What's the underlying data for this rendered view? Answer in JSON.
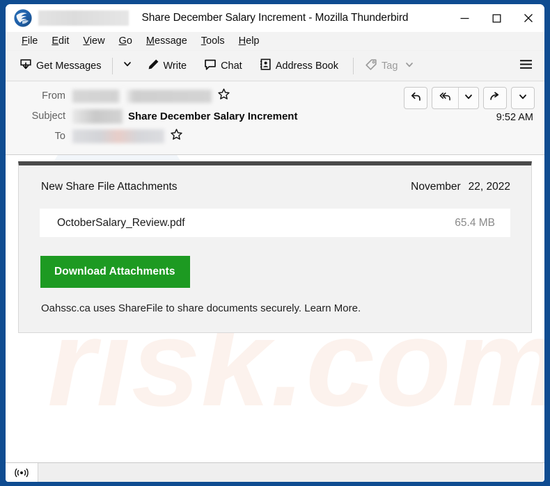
{
  "window": {
    "title": "Share December Salary Increment - Mozilla Thunderbird",
    "app_icon": "thunderbird-icon",
    "controls": {
      "minimize": "minimize-icon",
      "maximize": "maximize-icon",
      "close": "close-icon"
    }
  },
  "menubar": {
    "items": [
      {
        "label": "File",
        "accel": "F"
      },
      {
        "label": "Edit",
        "accel": "E"
      },
      {
        "label": "View",
        "accel": "V"
      },
      {
        "label": "Go",
        "accel": "G"
      },
      {
        "label": "Message",
        "accel": "M"
      },
      {
        "label": "Tools",
        "accel": "T"
      },
      {
        "label": "Help",
        "accel": "H"
      }
    ]
  },
  "toolbar": {
    "get_messages_label": "Get Messages",
    "get_messages_icon": "inbox-download-icon",
    "get_messages_caret": "chevron-down-icon",
    "write_label": "Write",
    "write_icon": "pencil-icon",
    "chat_label": "Chat",
    "chat_icon": "chat-bubble-icon",
    "address_book_label": "Address Book",
    "address_book_icon": "address-book-icon",
    "tag_label": "Tag",
    "tag_icon": "tag-icon",
    "tag_caret": "chevron-down-icon",
    "tag_disabled": true,
    "app_menu_icon": "hamburger-menu-icon"
  },
  "message_header": {
    "from_label": "From",
    "from_value": "",
    "from_redacted": true,
    "from_star_icon": "star-icon",
    "subject_label": "Subject",
    "subject_prefix_redacted": true,
    "subject_value": "Share December Salary Increment",
    "to_label": "To",
    "to_value": "",
    "to_redacted": true,
    "to_star_icon": "star-icon",
    "time": "9:52 AM",
    "actions": {
      "reply_icon": "reply-icon",
      "reply_all_icon": "reply-all-icon",
      "reply_all_caret_icon": "chevron-down-icon",
      "forward_icon": "forward-arrow-icon",
      "more_caret_icon": "chevron-down-icon"
    }
  },
  "email_body": {
    "heading": "New Share File Attachments",
    "date_month": "November",
    "date_day_year": "22, 2022",
    "attachment": {
      "name": "OctoberSalary_Review.pdf",
      "size": "65.4 MB"
    },
    "download_button_label": "Download Attachments",
    "footer_text": "Oahssc.ca uses ShareFile to share documents securely. ",
    "footer_link": "Learn More.",
    "accent_color": "#1d9a22",
    "card_top_bar_color": "#4a4a4a"
  },
  "statusbar": {
    "icon": "broadcast-signal-icon",
    "icon_glyph": "((•))",
    "text": ""
  }
}
